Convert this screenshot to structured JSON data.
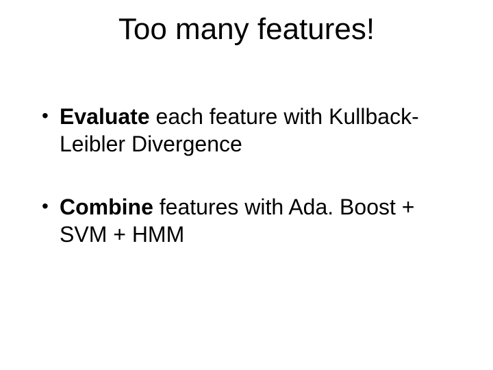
{
  "title": "Too many features!",
  "bullets": [
    {
      "bold": "Evaluate",
      "rest": " each feature with Kullback-Leibler Divergence"
    },
    {
      "bold": "Combine",
      "rest": " features with Ada. Boost + SVM + HMM"
    }
  ]
}
